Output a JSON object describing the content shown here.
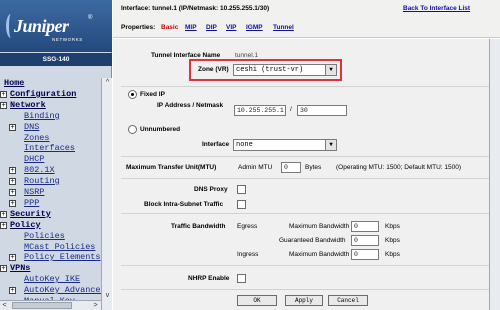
{
  "sidebar": {
    "logo_text": "Juniper",
    "logo_sub": "NETWORKS",
    "logo_tm": "®",
    "device": "SSG-140",
    "nav": [
      {
        "label": "Home",
        "level": 1,
        "expander": false
      },
      {
        "label": "Configuration",
        "level": 1,
        "expander": true
      },
      {
        "label": "Network",
        "level": 1,
        "expander": true
      },
      {
        "label": "Binding",
        "level": 2,
        "expander": false
      },
      {
        "label": "DNS",
        "level": 2,
        "expander": true
      },
      {
        "label": "Zones",
        "level": 2,
        "expander": false
      },
      {
        "label": "Interfaces",
        "level": 2,
        "expander": false
      },
      {
        "label": "DHCP",
        "level": 2,
        "expander": false
      },
      {
        "label": "802.1X",
        "level": 2,
        "expander": true
      },
      {
        "label": "Routing",
        "level": 2,
        "expander": true
      },
      {
        "label": "NSRP",
        "level": 2,
        "expander": true
      },
      {
        "label": "PPP",
        "level": 2,
        "expander": true
      },
      {
        "label": "Security",
        "level": 1,
        "expander": true
      },
      {
        "label": "Policy",
        "level": 1,
        "expander": true
      },
      {
        "label": "Policies",
        "level": 2,
        "expander": false
      },
      {
        "label": "MCast Policies",
        "level": 2,
        "expander": false
      },
      {
        "label": "Policy Elements",
        "level": 2,
        "expander": true
      },
      {
        "label": "VPNs",
        "level": 1,
        "expander": true
      },
      {
        "label": "AutoKey IKE",
        "level": 2,
        "expander": false
      },
      {
        "label": "AutoKey Advanced",
        "level": 2,
        "expander": true
      },
      {
        "label": "Manual Key",
        "level": 2,
        "expander": false
      }
    ]
  },
  "header": {
    "interface_info": "Interface: tunnel.1 (IP/Netmask: 10.255.255.1/30)",
    "back_link": "Back To Interface List",
    "properties_label": "Properties:",
    "tabs": [
      "Basic",
      "MIP",
      "DIP",
      "VIP",
      "IGMP",
      "Tunnel"
    ],
    "active_tab": "Basic"
  },
  "form": {
    "tunnel_name_label": "Tunnel Interface Name",
    "tunnel_name_value": "tunnel.1",
    "zone_label": "Zone (VR)",
    "zone_value": "ceshi (trust-vr)",
    "fixed_ip_label": "Fixed IP",
    "ip_label": "IP Address / Netmask",
    "ip_value": "10.255.255.1",
    "netmask_separator": "/",
    "netmask_value": "30",
    "unnumbered_label": "Unnumbered",
    "interface_label": "Interface",
    "interface_value": "none",
    "mtu_label": "Maximum Transfer Unit(MTU)",
    "admin_mtu_label": "Admin MTU",
    "admin_mtu_value": "0",
    "bytes_label": "Bytes",
    "mtu_note": "(Operating MTU: 1500; Default MTU: 1500)",
    "dns_proxy_label": "DNS Proxy",
    "block_intra_label": "Block Intra-Subnet Traffic",
    "traffic_bw_label": "Traffic Bandwidth",
    "egress_label": "Egress",
    "ingress_label": "Ingress",
    "max_bw_label": "Maximum Bandwidth",
    "guaranteed_bw_label": "Guaranteed Bandwidth",
    "egress_max_value": "0",
    "egress_guaranteed_value": "0",
    "ingress_max_value": "0",
    "kbps": "Kbps",
    "nhrp_label": "NHRP Enable",
    "ok_label": "OK",
    "apply_label": "Apply",
    "cancel_label": "Cancel"
  },
  "colors": {
    "active_tab": "#cc0000",
    "link": "#1010a0",
    "highlight_box": "#e0323a"
  }
}
